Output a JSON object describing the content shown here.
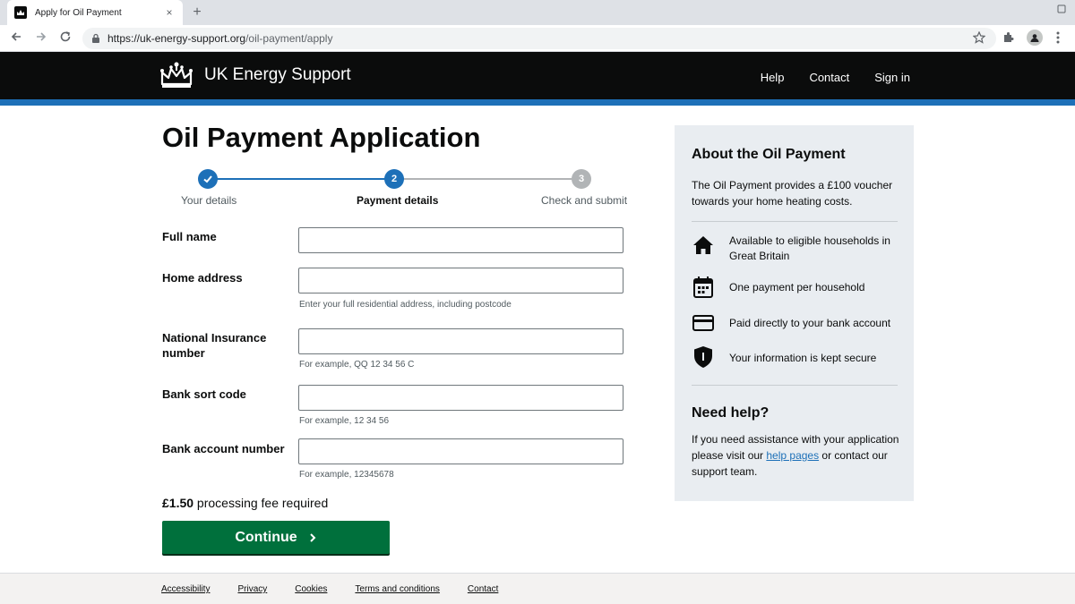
{
  "browser": {
    "tab_title": "Apply for Oil Payment",
    "tab_close": "×",
    "new_tab": "+",
    "url_host": "https://uk-energy-support.org",
    "url_path": "/oil-payment/apply",
    "icons": [
      "back-icon",
      "forward-icon",
      "reload-icon",
      "lock-icon",
      "star-icon",
      "extensions-icon",
      "profile-icon",
      "menu-icon"
    ]
  },
  "header": {
    "brand": "UK Energy Support",
    "nav": [
      "Help",
      "Contact",
      "Sign in"
    ]
  },
  "page": {
    "title": "Oil Payment Application"
  },
  "stepper": {
    "steps": [
      {
        "label": "Your details",
        "number": "✓",
        "state": "complete"
      },
      {
        "label": "Payment details",
        "number": "2",
        "state": "current"
      },
      {
        "label": "Check and submit",
        "number": "3",
        "state": "upcoming"
      }
    ],
    "colors": {
      "active": "#1d70b8",
      "inactive": "#b1b4b6"
    }
  },
  "form": {
    "fields": [
      {
        "label": "Full name",
        "value": "",
        "hint": ""
      },
      {
        "label": "Home address",
        "value": "",
        "hint": "Enter your full residential address, including postcode"
      },
      {
        "label": "National Insurance number",
        "value": "",
        "hint": "For example, QQ 12 34 56 C"
      },
      {
        "label": "Bank sort code",
        "value": "",
        "hint": "For example, 12 34 56"
      },
      {
        "label": "Bank account number",
        "value": "",
        "hint": "For example, 12345678"
      }
    ],
    "fee_amount": "£1.50",
    "fee_text": " processing fee required",
    "continue_label": "Continue",
    "continue_color": "#00703c"
  },
  "sidebar": {
    "title": "About the Oil Payment",
    "intro": "The Oil Payment provides a £100 voucher towards your home heating costs.",
    "items": [
      {
        "icon": "house-icon",
        "text": "Available to eligible households in Great Britain"
      },
      {
        "icon": "calendar-icon",
        "text": "One payment per household"
      },
      {
        "icon": "card-icon",
        "text": "Paid directly to your bank account"
      },
      {
        "icon": "shield-icon",
        "text": "Your information is kept secure"
      }
    ],
    "help_title": "Need help?",
    "help_text_1": "If you need assistance with your application please visit our ",
    "help_link": "help pages",
    "help_text_2": " or contact our support team."
  },
  "footer": {
    "links": [
      "Accessibility",
      "Privacy",
      "Cookies",
      "Terms and conditions",
      "Contact"
    ]
  }
}
